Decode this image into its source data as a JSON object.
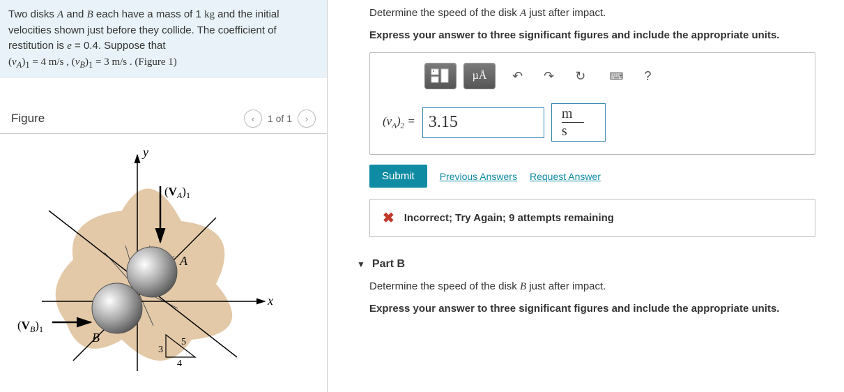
{
  "problem": {
    "line1_pre": "Two disks ",
    "A": "A",
    "line1_mid": " and ",
    "B": "B",
    "line1_post": " each have a mass of 1 ",
    "kg": "kg",
    "line1_end": " and the initial velocities shown just before they collide. The coefficient of restitution is ",
    "e": "e",
    "eval": " = 0.4. Suppose that ",
    "vA1": "(v_A)_1",
    "vA1val": " = 4  m/s , ",
    "vB1": "(v_B)_1",
    "vB1val": " = 3  m/s . (Figure 1)"
  },
  "figure": {
    "title": "Figure",
    "pager": "1 of 1",
    "labels": {
      "y": "y",
      "x": "x",
      "VA1": "(V_A)_1",
      "VB1": "(V_B)_1",
      "A": "A",
      "B": "B",
      "t3": "3",
      "t4": "4",
      "t5": "5"
    }
  },
  "partA": {
    "prompt_pre": "Determine the speed of the disk ",
    "prompt_A": "A",
    "prompt_post": " just after impact.",
    "instruction": "Express your answer to three significant figures and include the appropriate units.",
    "toolbar": {
      "units": "µÅ",
      "help": "?"
    },
    "answer_label_pre": "(v",
    "answer_label_sub": "A",
    "answer_label_post": ")",
    "answer_label_sub2": "2",
    "answer_label_eq": " = ",
    "answer_value": "3.15",
    "unit_top": "m",
    "unit_bot": "s",
    "submit": "Submit",
    "prev": "Previous Answers",
    "req": "Request Answer",
    "feedback": "Incorrect; Try Again; 9 attempts remaining"
  },
  "partB": {
    "title": "Part B",
    "prompt_pre": "Determine the speed of the disk ",
    "prompt_B": "B",
    "prompt_post": " just after impact.",
    "instruction": "Express your answer to three significant figures and include the appropriate units."
  }
}
